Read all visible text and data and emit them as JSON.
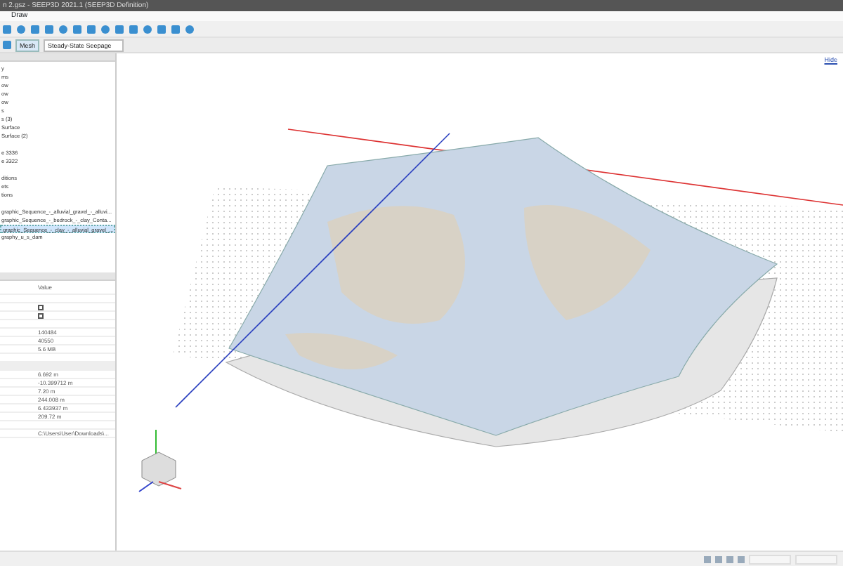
{
  "window": {
    "title": "n 2.gsz - SEEP3D 2021.1 (SEEP3D Definition)"
  },
  "menu": [
    "Draw"
  ],
  "view_toolbar": {
    "mode": "Mesh",
    "analysis": "Steady-State Seepage"
  },
  "tree": {
    "items": [
      {
        "label": "y",
        "selected": false
      },
      {
        "label": "ms",
        "selected": false
      },
      {
        "label": "ow",
        "selected": false
      },
      {
        "label": "ow",
        "selected": false
      },
      {
        "label": "ow",
        "selected": false
      },
      {
        "label": "s",
        "selected": false
      },
      {
        "label": "s (3)",
        "selected": false
      },
      {
        "label": "Surface",
        "selected": false
      },
      {
        "label": "Surface (2)",
        "selected": false
      },
      {
        "label": "e 3336",
        "selected": false
      },
      {
        "label": "e 3322",
        "selected": false
      },
      {
        "label": "ditions",
        "selected": false
      },
      {
        "label": "ets",
        "selected": false
      },
      {
        "label": "tions",
        "selected": false
      },
      {
        "label": "graphic_Sequence_-_alluvial_gravel_-_alluvi...",
        "selected": false
      },
      {
        "label": "graphic_Sequence_-_bedrock_-_clay_Conta...",
        "selected": false
      },
      {
        "label": "graphic_Sequence_-_clay_-_alluvial_gravel_...",
        "selected": true
      },
      {
        "label": "graphy_u_s_dam",
        "selected": false
      }
    ]
  },
  "properties": {
    "column": "Value",
    "rows": [
      {
        "kind": "blank"
      },
      {
        "kind": "checkbox",
        "checked": false
      },
      {
        "kind": "checkbox",
        "checked": false
      },
      {
        "kind": "blank"
      },
      {
        "kind": "value",
        "value": "140484"
      },
      {
        "kind": "value",
        "value": "40550"
      },
      {
        "kind": "value",
        "value": "5.6 MB"
      },
      {
        "kind": "blank"
      },
      {
        "kind": "section"
      },
      {
        "kind": "value",
        "value": "6.692 m"
      },
      {
        "kind": "value",
        "value": "-10.399712 m"
      },
      {
        "kind": "value",
        "value": "7.20 m"
      },
      {
        "kind": "value",
        "value": "244.008 m"
      },
      {
        "kind": "value",
        "value": "6.433937 m"
      },
      {
        "kind": "value",
        "value": "209.72 m"
      },
      {
        "kind": "blank"
      },
      {
        "kind": "value",
        "value": "C:\\Users\\User\\Downloads\\..."
      }
    ]
  },
  "viewport": {
    "link": "Hide"
  }
}
